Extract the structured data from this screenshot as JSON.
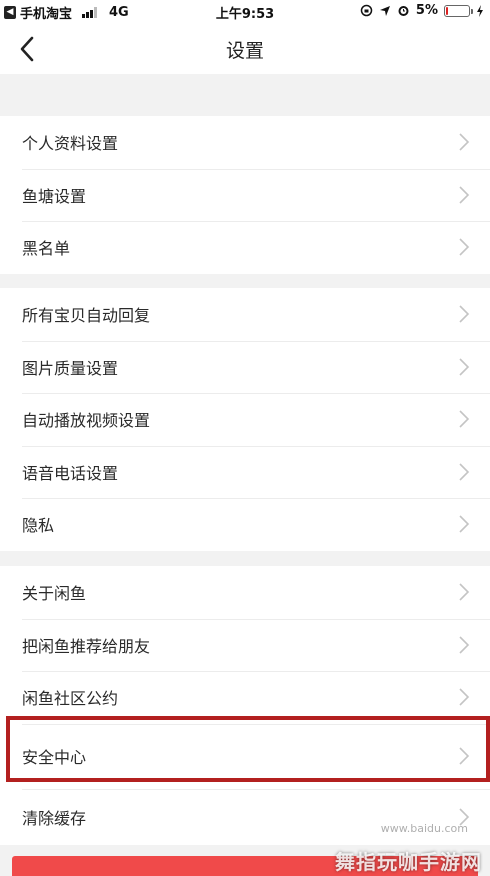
{
  "status_bar": {
    "app_back": "手机淘宝",
    "network": "4G",
    "time": "上午9:53",
    "battery_percent": "5%",
    "battery_level": 0.05
  },
  "nav": {
    "title": "设置"
  },
  "sections": [
    {
      "items": [
        {
          "label": "个人资料设置"
        },
        {
          "label": "鱼塘设置"
        },
        {
          "label": "黑名单"
        }
      ]
    },
    {
      "items": [
        {
          "label": "所有宝贝自动回复"
        },
        {
          "label": "图片质量设置"
        },
        {
          "label": "自动播放视频设置"
        },
        {
          "label": "语音电话设置"
        },
        {
          "label": "隐私"
        }
      ]
    },
    {
      "items": [
        {
          "label": "关于闲鱼"
        },
        {
          "label": "把闲鱼推荐给朋友"
        },
        {
          "label": "闲鱼社区公约"
        },
        {
          "label": "安全中心"
        },
        {
          "label": "清除缓存"
        }
      ]
    }
  ],
  "highlighted_item": "安全中心",
  "colors": {
    "highlight_border": "#b3201f",
    "logout_button": "#f04a4a"
  },
  "watermark": {
    "top": "www.baidu.com",
    "bottom": "舞指玩咖手游网"
  }
}
